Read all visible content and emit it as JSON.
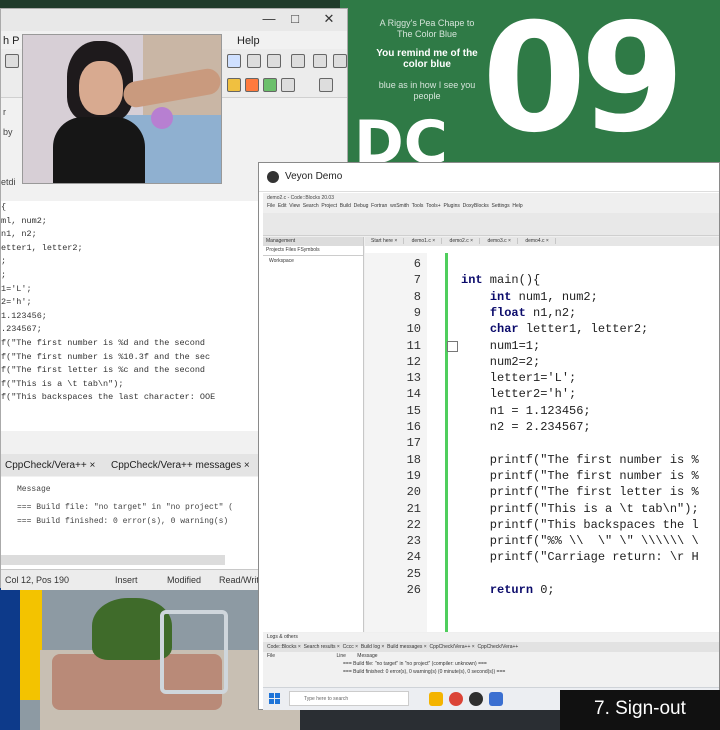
{
  "poster": {
    "big_number": "09",
    "big_letters": "DC",
    "quote_top": "A Riggy's Pea Chape to The Color Blue",
    "quote_main": "You remind me of the color blue",
    "quote_bottom": "blue as in how I see you people"
  },
  "left_window": {
    "title_fragment": "",
    "menu_fragment": "h  P",
    "menu_help": "Help",
    "sidebar_fragments": [
      "r",
      "by",
      "etdi"
    ],
    "code_lines": [
      "{",
      "ml, num2;",
      "n1, n2;",
      "etter1, letter2;",
      ";",
      ";",
      "1='L';",
      "2='h';",
      "1.123456;",
      ".234567;",
      "",
      "f(\"The first number is %d and the second ",
      "f(\"The first number is %10.3f and the sec",
      "f(\"The first letter is %c and the second ",
      "f(\"This is a \\t tab\\n\");",
      "f(\"This backspaces the last character: OOE"
    ],
    "bottom_tabs": [
      "CppCheck/Vera++ ×",
      "CppCheck/Vera++ messages ×"
    ],
    "log_header": "Message",
    "log_lines": [
      "=== Build file: \"no target\" in \"no project\" (",
      "=== Build finished: 0 error(s), 0 warning(s)"
    ],
    "status": {
      "position": "Col 12, Pos 190",
      "mode": "Insert",
      "modified": "Modified",
      "access": "Read/Write"
    }
  },
  "veyon": {
    "title": "Veyon Demo",
    "codeblocks_title": "demo2.c - Code::Blocks 20.03",
    "menu_items": [
      "File",
      "Edit",
      "View",
      "Search",
      "Project",
      "Build",
      "Debug",
      "Fortran",
      "wxSmith",
      "Tools",
      "Tools+",
      "Plugins",
      "DoxyBlocks",
      "Settings",
      "Help"
    ],
    "management_title": "Management",
    "management_tabs": "Projects   Files   FSymbols",
    "workspace": "Workspace",
    "editor_tabs": [
      "Start here ×",
      "demo1.c ×",
      "demo2.c ×",
      "demo3.c ×",
      "demo4.c ×"
    ],
    "code": [
      {
        "num": "6",
        "text": ""
      },
      {
        "num": "7",
        "text": "int main(){"
      },
      {
        "num": "8",
        "text": "    int num1, num2;"
      },
      {
        "num": "9",
        "text": "    float n1,n2;"
      },
      {
        "num": "10",
        "text": "    char letter1, letter2;"
      },
      {
        "num": "11",
        "text": "    num1=1;"
      },
      {
        "num": "12",
        "text": "    num2=2;"
      },
      {
        "num": "13",
        "text": "    letter1='L';"
      },
      {
        "num": "14",
        "text": "    letter2='h';"
      },
      {
        "num": "15",
        "text": "    n1 = 1.123456;"
      },
      {
        "num": "16",
        "text": "    n2 = 2.234567;"
      },
      {
        "num": "17",
        "text": ""
      },
      {
        "num": "18",
        "text": "    printf(\"The first number is %"
      },
      {
        "num": "19",
        "text": "    printf(\"The first number is %"
      },
      {
        "num": "20",
        "text": "    printf(\"The first letter is %"
      },
      {
        "num": "21",
        "text": "    printf(\"This is a \\t tab\\n\");"
      },
      {
        "num": "22",
        "text": "    printf(\"This backspaces the l"
      },
      {
        "num": "23",
        "text": "    printf(\"%% \\\\  \\\" \\\" \\\\\\\\\\\\ \\"
      },
      {
        "num": "24",
        "text": "    printf(\"Carriage return: \\r H"
      },
      {
        "num": "25",
        "text": ""
      },
      {
        "num": "26",
        "text": "    return 0;"
      }
    ],
    "logs_title": "Logs & others",
    "logs_tabs": [
      "Code::Blocks ×",
      "Search results ×",
      "Cccc ×",
      "Build log ×",
      "Build messages ×",
      "CppCheck/Vera++ ×",
      "CppCheck/Vera++"
    ],
    "logs_header": [
      "File",
      "Line",
      "Message"
    ],
    "logs_rows": [
      "=== Build file: \"no target\" in \"no project\" (compiler: unknown) ===",
      "=== Build finished: 0 error(s), 0 warning(s) (0 minute(s), 0 second(s)) ==="
    ],
    "search_placeholder": "Type here to search"
  },
  "signout": "7. Sign-out"
}
